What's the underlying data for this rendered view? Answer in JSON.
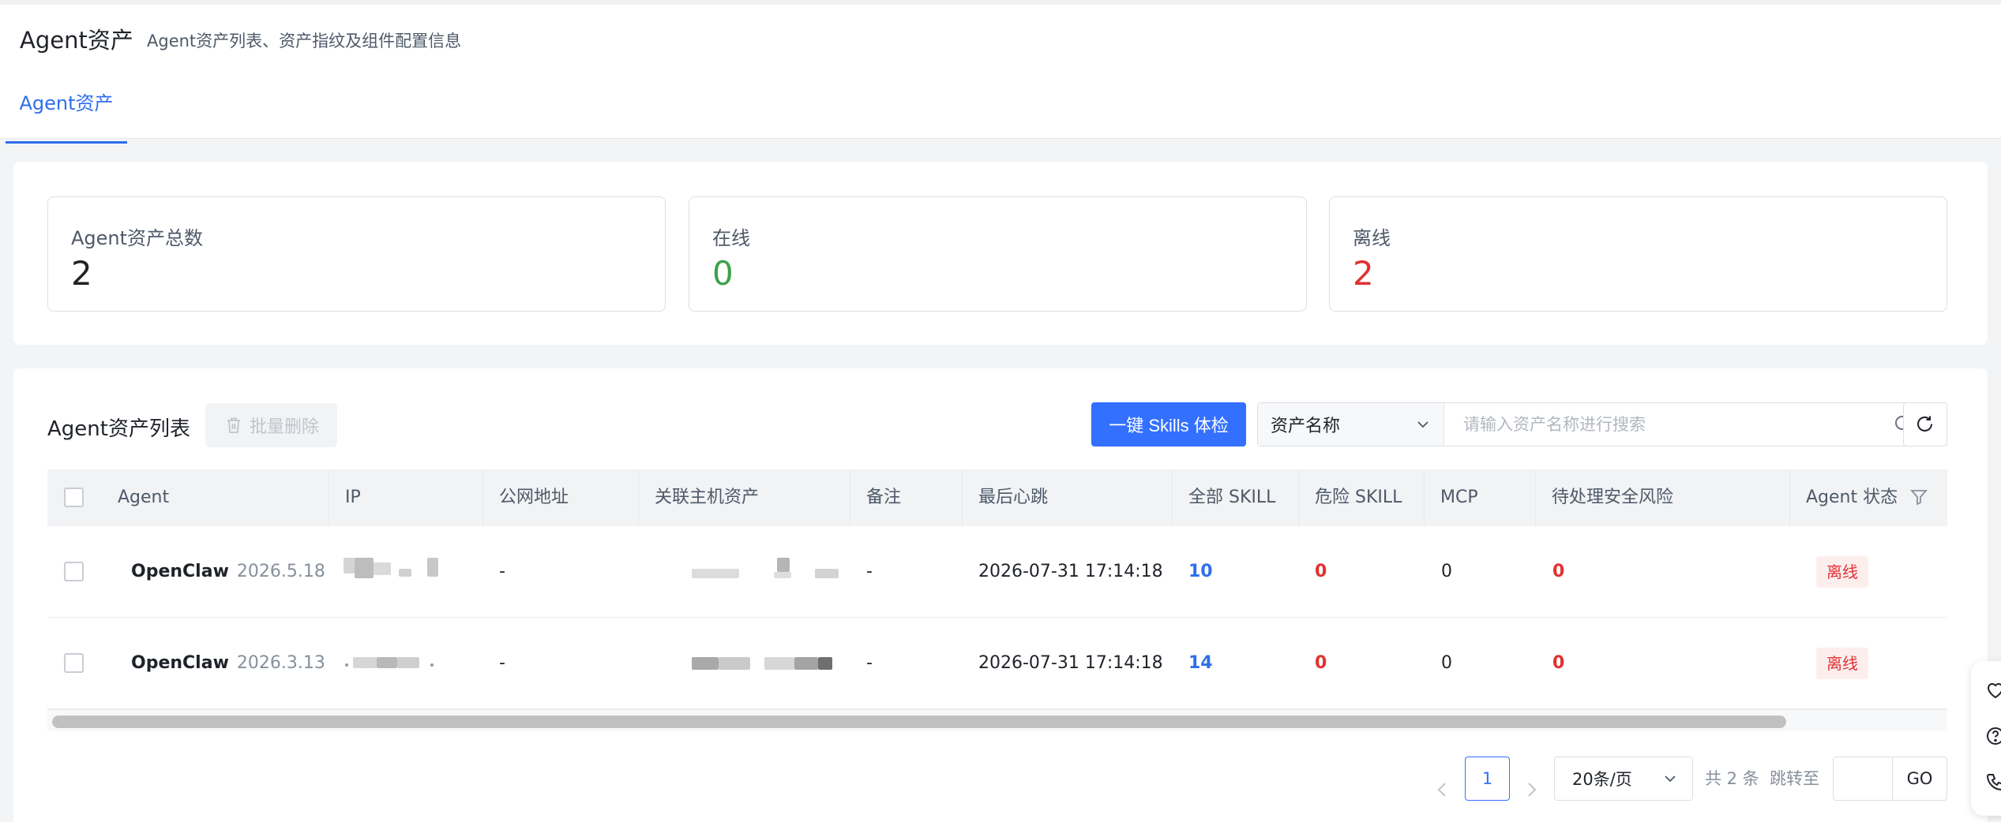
{
  "header": {
    "title": "Agent资产",
    "subtitle": "Agent资产列表、资产指纹及组件配置信息",
    "tabs": [
      {
        "label": "Agent资产",
        "active": true
      }
    ]
  },
  "stats": [
    {
      "label": "Agent资产总数",
      "value": "2",
      "color": "#1f2329"
    },
    {
      "label": "在线",
      "value": "0",
      "color": "#3da14a"
    },
    {
      "label": "离线",
      "value": "2",
      "color": "#e03131"
    }
  ],
  "list": {
    "title": "Agent资产列表",
    "batch_delete_label": "批量删除",
    "skills_check_label": "一键 Skills 体检",
    "search_field_label": "资产名称",
    "search_placeholder": "请输入资产名称进行搜索"
  },
  "table": {
    "headers": {
      "agent": "Agent",
      "ip": "IP",
      "public_addr": "公网地址",
      "host_asset": "关联主机资产",
      "remark": "备注",
      "last_heartbeat": "最后心跳",
      "all_skill": "全部 SKILL",
      "danger_skill": "危险 SKILL",
      "mcp": "MCP",
      "pending_risk": "待处理安全风险",
      "agent_status": "Agent 状态"
    },
    "rows": [
      {
        "agent_name": "OpenClaw",
        "agent_version": "2026.5.18",
        "public_addr": "-",
        "remark": "-",
        "last_heartbeat": "2026-07-31 17:14:18",
        "all_skill": "10",
        "danger_skill": "0",
        "mcp": "0",
        "pending_risk": "0",
        "status": "离线"
      },
      {
        "agent_name": "OpenClaw",
        "agent_version": "2026.3.13",
        "public_addr": "-",
        "remark": "-",
        "last_heartbeat": "2026-07-31 17:14:18",
        "all_skill": "14",
        "danger_skill": "0",
        "mcp": "0",
        "pending_risk": "0",
        "status": "离线"
      }
    ]
  },
  "pagination": {
    "current_page": "1",
    "page_size": "20条/页",
    "total": "共 2 条",
    "jump_label": "跳转至",
    "go_label": "GO"
  },
  "colors": {
    "accent": "#3370ff",
    "danger": "#e03131",
    "success": "#3da14a"
  },
  "icons": [
    "trash-icon",
    "chevron-down-icon",
    "search-icon",
    "refresh-icon",
    "filter-icon",
    "chevron-left-icon",
    "chevron-right-icon",
    "heart-icon",
    "help-icon",
    "phone-icon"
  ]
}
